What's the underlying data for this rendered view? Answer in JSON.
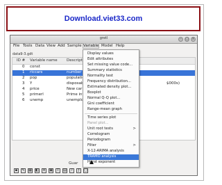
{
  "banner": {
    "text": "Download.viet33.com"
  },
  "window": {
    "title": "gretl"
  },
  "menubar": [
    {
      "label": "File"
    },
    {
      "label": "Tools"
    },
    {
      "label": "Data"
    },
    {
      "label": "View"
    },
    {
      "label": "Add"
    },
    {
      "label": "Sample"
    },
    {
      "label": "Variable"
    },
    {
      "label": "Model"
    },
    {
      "label": "Help"
    }
  ],
  "dataset_file": "data9-3.gdt",
  "table": {
    "headers": {
      "id": "ID #",
      "name": "Variable name",
      "desc": "Descripti"
    },
    "rows": [
      {
        "id": "0",
        "name": "const",
        "desc": ""
      },
      {
        "id": "1",
        "name": "riccars",
        "desc": "number of"
      },
      {
        "id": "2",
        "name": "pop",
        "desc": "population"
      },
      {
        "id": "3",
        "name": "Y",
        "desc": "disposable"
      },
      {
        "id": "4",
        "name": "price",
        "desc": "New car pr"
      },
      {
        "id": "5",
        "name": "primerl",
        "desc": "Prime inter"
      },
      {
        "id": "6",
        "name": "unemp",
        "desc": "unemploym"
      }
    ],
    "row3_extra": "$000s)"
  },
  "status": {
    "text": "Guar"
  },
  "variable_menu": {
    "items": [
      {
        "label": "Display values",
        "disabled": false,
        "submenu": false
      },
      {
        "label": "Edit attributes",
        "disabled": false,
        "submenu": false
      },
      {
        "label": "Set missing value code...",
        "disabled": false,
        "submenu": false
      },
      {
        "label": "Summary statistics",
        "disabled": false,
        "submenu": false
      },
      {
        "label": "Normality test",
        "disabled": false,
        "submenu": false
      },
      {
        "label": "Frequency distribution...",
        "disabled": false,
        "submenu": false
      },
      {
        "label": "Estimated density plot...",
        "disabled": false,
        "submenu": false
      },
      {
        "label": "Boxplot",
        "disabled": false,
        "submenu": false
      },
      {
        "label": "Normal Q-Q plot...",
        "disabled": false,
        "submenu": false
      },
      {
        "label": "Gini coefficient",
        "disabled": false,
        "submenu": false
      },
      {
        "label": "Range-mean graph",
        "disabled": false,
        "submenu": false
      },
      {
        "label": "Time series plot",
        "disabled": false,
        "submenu": false
      },
      {
        "label": "Panel plot...",
        "disabled": true,
        "submenu": false
      },
      {
        "label": "Unit root tests",
        "disabled": false,
        "submenu": true
      },
      {
        "label": "Correlogram",
        "disabled": false,
        "submenu": false
      },
      {
        "label": "Periodogram",
        "disabled": false,
        "submenu": false
      },
      {
        "label": "Filter",
        "disabled": false,
        "submenu": true
      },
      {
        "label": "X-12-ARIMA analysis",
        "disabled": false,
        "submenu": false
      },
      {
        "label": "TRAMO analysis",
        "disabled": false,
        "submenu": false,
        "highlighted": true
      },
      {
        "label": "Hurst exponent",
        "disabled": false,
        "submenu": false
      }
    ],
    "submenu_arrow": ">"
  },
  "toolbar_icons": [
    "terminal-icon",
    "edit-icon",
    "calculator-icon",
    "session-icon",
    "script-icon",
    "console-icon",
    "text-icon",
    "chart-icon",
    "help-icon",
    "function-icon",
    "window-icon"
  ]
}
